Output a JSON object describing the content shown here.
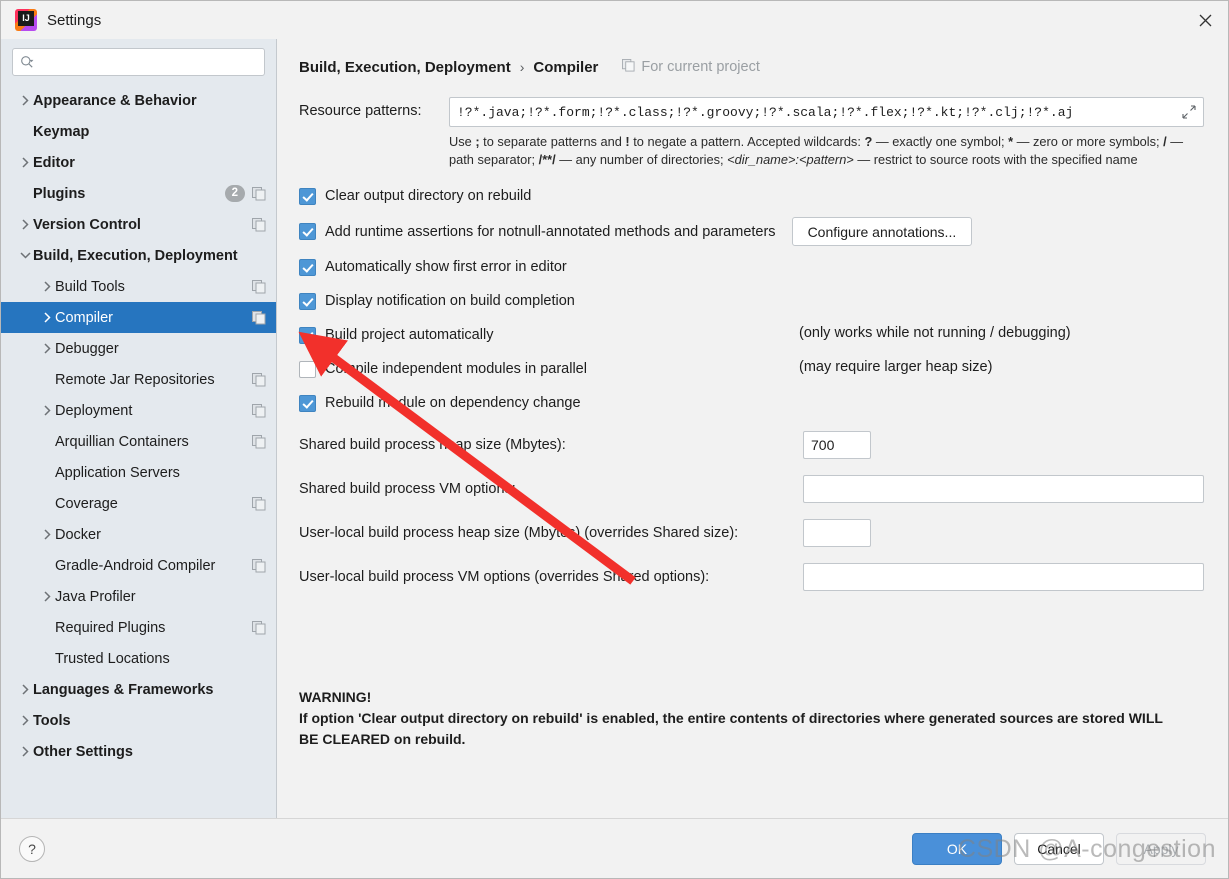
{
  "window": {
    "title": "Settings",
    "logo_icon": "intellij-idea-logo",
    "close_icon": "close-icon"
  },
  "sidebar": {
    "search": {
      "placeholder": "",
      "value": "",
      "icon": "search-icon"
    },
    "items": [
      {
        "label": "Appearance & Behavior",
        "level": 0,
        "bold": true,
        "arrow": "chevron-right",
        "badge": "",
        "copy_icon": false,
        "selected": false
      },
      {
        "label": "Keymap",
        "level": 0,
        "bold": true,
        "arrow": "",
        "badge": "",
        "copy_icon": false,
        "selected": false
      },
      {
        "label": "Editor",
        "level": 0,
        "bold": true,
        "arrow": "chevron-right",
        "badge": "",
        "copy_icon": false,
        "selected": false
      },
      {
        "label": "Plugins",
        "level": 0,
        "bold": true,
        "arrow": "",
        "badge": "2",
        "copy_icon": true,
        "selected": false
      },
      {
        "label": "Version Control",
        "level": 0,
        "bold": true,
        "arrow": "chevron-right",
        "badge": "",
        "copy_icon": true,
        "selected": false
      },
      {
        "label": "Build, Execution, Deployment",
        "level": 0,
        "bold": true,
        "arrow": "chevron-down",
        "badge": "",
        "copy_icon": false,
        "selected": false
      },
      {
        "label": "Build Tools",
        "level": 1,
        "bold": false,
        "arrow": "chevron-right",
        "badge": "",
        "copy_icon": true,
        "selected": false
      },
      {
        "label": "Compiler",
        "level": 1,
        "bold": false,
        "arrow": "chevron-right",
        "badge": "",
        "copy_icon": true,
        "selected": true
      },
      {
        "label": "Debugger",
        "level": 1,
        "bold": false,
        "arrow": "chevron-right",
        "badge": "",
        "copy_icon": false,
        "selected": false
      },
      {
        "label": "Remote Jar Repositories",
        "level": 1,
        "bold": false,
        "arrow": "",
        "badge": "",
        "copy_icon": true,
        "selected": false
      },
      {
        "label": "Deployment",
        "level": 1,
        "bold": false,
        "arrow": "chevron-right",
        "badge": "",
        "copy_icon": true,
        "selected": false
      },
      {
        "label": "Arquillian Containers",
        "level": 1,
        "bold": false,
        "arrow": "",
        "badge": "",
        "copy_icon": true,
        "selected": false
      },
      {
        "label": "Application Servers",
        "level": 1,
        "bold": false,
        "arrow": "",
        "badge": "",
        "copy_icon": false,
        "selected": false
      },
      {
        "label": "Coverage",
        "level": 1,
        "bold": false,
        "arrow": "",
        "badge": "",
        "copy_icon": true,
        "selected": false
      },
      {
        "label": "Docker",
        "level": 1,
        "bold": false,
        "arrow": "chevron-right",
        "badge": "",
        "copy_icon": false,
        "selected": false
      },
      {
        "label": "Gradle-Android Compiler",
        "level": 1,
        "bold": false,
        "arrow": "",
        "badge": "",
        "copy_icon": true,
        "selected": false
      },
      {
        "label": "Java Profiler",
        "level": 1,
        "bold": false,
        "arrow": "chevron-right",
        "badge": "",
        "copy_icon": false,
        "selected": false
      },
      {
        "label": "Required Plugins",
        "level": 1,
        "bold": false,
        "arrow": "",
        "badge": "",
        "copy_icon": true,
        "selected": false
      },
      {
        "label": "Trusted Locations",
        "level": 1,
        "bold": false,
        "arrow": "",
        "badge": "",
        "copy_icon": false,
        "selected": false
      },
      {
        "label": "Languages & Frameworks",
        "level": 0,
        "bold": true,
        "arrow": "chevron-right",
        "badge": "",
        "copy_icon": false,
        "selected": false
      },
      {
        "label": "Tools",
        "level": 0,
        "bold": true,
        "arrow": "chevron-right",
        "badge": "",
        "copy_icon": false,
        "selected": false
      },
      {
        "label": "Other Settings",
        "level": 0,
        "bold": true,
        "arrow": "chevron-right",
        "badge": "",
        "copy_icon": false,
        "selected": false
      }
    ]
  },
  "main": {
    "breadcrumb": {
      "root": "Build, Execution, Deployment",
      "separator": "›",
      "leaf": "Compiler",
      "scope_label": "For current project",
      "scope_icon": "copy-scope-icon"
    },
    "resource_patterns": {
      "label": "Resource patterns:",
      "value": "!?*.java;!?*.form;!?*.class;!?*.groovy;!?*.scala;!?*.flex;!?*.kt;!?*.clj;!?*.aj",
      "placeholder": "",
      "expand_icon": "expand-icon",
      "hint_line1_a": "Use ",
      "hint_semicolon": ";",
      "hint_line1_b": " to separate patterns and ",
      "hint_bang": "!",
      "hint_line1_c": " to negate a pattern. Accepted wildcards: ",
      "hint_q": "?",
      "hint_line1_d": " — exactly one symbol; ",
      "hint_star": "*",
      "hint_line1_e": " — zero or more symbols; ",
      "hint_slash": "/",
      "hint_line2_a": " — path separator; ",
      "hint_globstar": "/**/",
      "hint_line2_b": " — any number of directories; ",
      "hint_dirname": "<dir_name>:<pattern>",
      "hint_line2_c": " — restrict to source roots with the specified name"
    },
    "checkboxes": [
      {
        "label": "Clear output directory on rebuild",
        "checked": true,
        "mnemonic": "l",
        "note": "",
        "button": ""
      },
      {
        "label": "Add runtime assertions for notnull-annotated methods and parameters",
        "checked": true,
        "mnemonic": "a",
        "note": "",
        "button": "Configure annotations..."
      },
      {
        "label": "Automatically show first error in editor",
        "checked": true,
        "mnemonic": "e",
        "note": "",
        "button": ""
      },
      {
        "label": "Display notification on build completion",
        "checked": true,
        "mnemonic": "",
        "note": "",
        "button": ""
      },
      {
        "label": "Build project automatically",
        "checked": true,
        "mnemonic": "",
        "note": "(only works while not running / debugging)",
        "button": ""
      },
      {
        "label": "Compile independent modules in parallel",
        "checked": false,
        "mnemonic": "",
        "note": "(may require larger heap size)",
        "button": ""
      },
      {
        "label": "Rebuild module on dependency change",
        "checked": true,
        "mnemonic": "",
        "note": "",
        "button": ""
      }
    ],
    "configure_annotations_button": "Configure annotations...",
    "fields": [
      {
        "label": "Shared build process heap size (Mbytes):",
        "value": "700",
        "placeholder": "",
        "width": "narrow"
      },
      {
        "label": "Shared build process VM options:",
        "value": "",
        "placeholder": "",
        "width": "wide"
      },
      {
        "label": "User-local build process heap size (Mbytes) (overrides Shared size):",
        "value": "",
        "placeholder": "",
        "width": "narrow"
      },
      {
        "label": "User-local build process VM options (overrides Shared options):",
        "value": "",
        "placeholder": "",
        "width": "wide"
      }
    ],
    "warning": {
      "title": "WARNING!",
      "text": "If option 'Clear output directory on rebuild' is enabled, the entire contents of directories where generated sources are stored WILL BE CLEARED on rebuild."
    }
  },
  "footer": {
    "help_label": "?",
    "ok_label": "OK",
    "cancel_label": "Cancel",
    "apply_label": "Apply"
  },
  "annotation": {
    "arrow_color": "#f2302b",
    "watermark": "CSDN @A-congestion"
  },
  "colors": {
    "accent": "#2675bf",
    "checkbox_on": "#4e97d6",
    "ok_button": "#4a90d9",
    "sidebar_bg": "#e4e9ee",
    "panel_bg": "#f2f2f2"
  }
}
